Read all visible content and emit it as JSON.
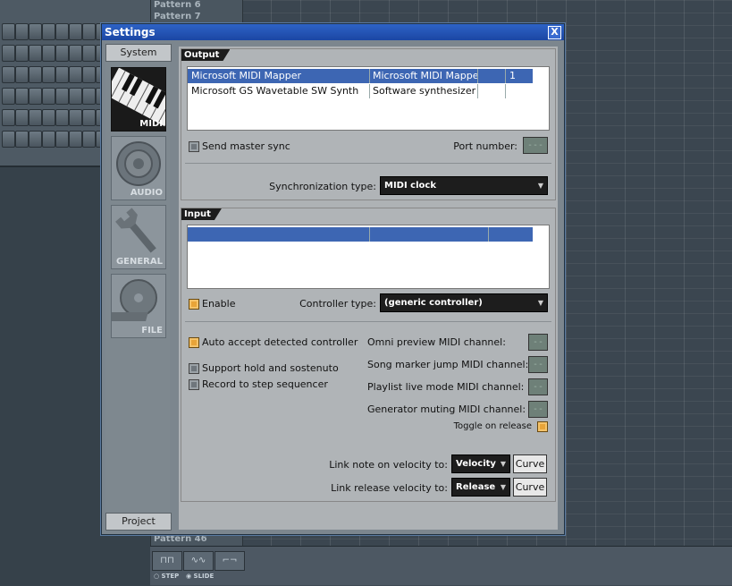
{
  "background": {
    "patterns_top": [
      "Pattern 6",
      "Pattern 7"
    ],
    "pattern_bottom": "Pattern 46",
    "tools": [
      "STEP",
      "SLIDE"
    ]
  },
  "dialog": {
    "title": "Settings",
    "close_label": "X"
  },
  "sidebar": {
    "system_label": "System",
    "project_label": "Project",
    "categories": [
      {
        "label": "MIDI",
        "icon": "keyboard-icon",
        "active": true
      },
      {
        "label": "AUDIO",
        "icon": "speaker-icon",
        "active": false
      },
      {
        "label": "GENERAL",
        "icon": "wrench-icon",
        "active": false
      },
      {
        "label": "FILE",
        "icon": "disk-icon",
        "active": false
      }
    ]
  },
  "output": {
    "header": "Output",
    "rows": [
      {
        "name": "Microsoft MIDI Mapper",
        "type": "Microsoft MIDI Mapper",
        "port": "1",
        "selected": true
      },
      {
        "name": "Microsoft GS Wavetable SW Synth",
        "type": "Software synthesizer",
        "port": "",
        "selected": false
      }
    ],
    "send_master_sync_label": "Send master sync",
    "port_number_label": "Port number:",
    "port_number_value": "---",
    "sync_type_label": "Synchronization type:",
    "sync_type_value": "MIDI clock"
  },
  "input": {
    "header": "Input",
    "enable_label": "Enable",
    "controller_type_label": "Controller type:",
    "controller_type_value": "(generic controller)",
    "auto_accept_label": "Auto accept detected controller",
    "support_hold_label": "Support hold and sostenuto",
    "record_step_label": "Record to step sequencer",
    "omni_label": "Omni preview MIDI channel:",
    "song_marker_label": "Song marker jump MIDI channel:",
    "playlist_label": "Playlist live mode MIDI channel:",
    "generator_label": "Generator muting MIDI channel:",
    "channel_value": "--",
    "toggle_release_label": "Toggle on release",
    "link_note_label": "Link note on velocity to:",
    "link_note_value": "Velocity",
    "link_release_label": "Link release velocity to:",
    "link_release_value": "Release",
    "curve_label": "Curve"
  }
}
